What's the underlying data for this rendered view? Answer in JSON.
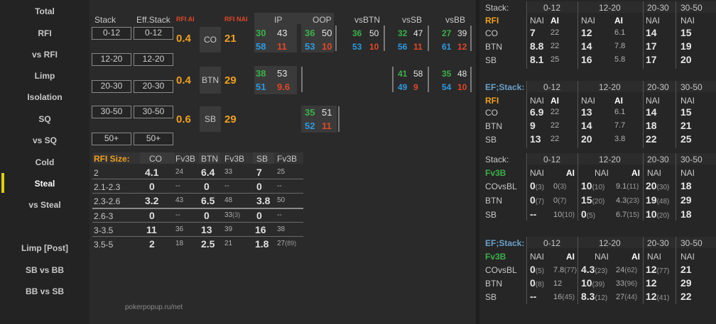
{
  "sidebar": {
    "items": [
      "Total",
      "RFI",
      "vs RFI",
      "Limp",
      "Isolation",
      "SQ",
      "vs SQ",
      "Cold",
      "Steal",
      "vs Steal",
      "Limp [Post]",
      "SB vs BB",
      "BB vs SB"
    ]
  },
  "center": {
    "headers": {
      "stack": "Stack",
      "eff_stack": "Eff.Stack",
      "rfi_ai": "RFI AI",
      "rfi_nai": "RFI NAI",
      "ip": "IP",
      "oop": "OOP",
      "vsbtn": "vsBTN",
      "vssb": "vsSB",
      "vsbb": "vsBB"
    },
    "stack_boxes": [
      [
        "0-12",
        "0-12"
      ],
      [
        "12-20",
        "12-20"
      ],
      [
        "20-30",
        "20-30"
      ],
      [
        "30-50",
        "30-50"
      ],
      [
        "50+",
        "50+"
      ]
    ],
    "rows": [
      {
        "ai": "0.4",
        "pos": "CO",
        "nai": "21",
        "ip": [
          "30",
          "43",
          "58",
          "11"
        ],
        "oop": [
          "36",
          "50",
          "53",
          "10"
        ],
        "vsbtn": [
          "36",
          "50",
          "53",
          "10"
        ],
        "vssb": [
          "32",
          "47",
          "56",
          "11"
        ],
        "vsbb": [
          "27",
          "39",
          "61",
          "12"
        ]
      },
      {
        "ai": "0.4",
        "pos": "BTN",
        "nai": "29",
        "ip": [
          "38",
          "53",
          "51",
          "9.6"
        ],
        "vssb": [
          "41",
          "58",
          "49",
          "9"
        ],
        "vsbb": [
          "35",
          "48",
          "54",
          "10"
        ]
      },
      {
        "ai": "0.6",
        "pos": "SB",
        "nai": "29",
        "vsbb": [
          "35",
          "51",
          "52",
          "11"
        ]
      }
    ],
    "size_table": {
      "headers": [
        "RFI Size:",
        "CO",
        "Fv3B",
        "BTN",
        "Fv3B",
        "SB",
        "Fv3B"
      ],
      "rows": [
        [
          "2",
          "4.1",
          "24",
          "6.4",
          "33",
          "7",
          "25"
        ],
        [
          "2.1-2.3",
          "0",
          "--",
          "0",
          "--",
          "0",
          "--"
        ],
        [
          "2.3-2.6",
          "3.2",
          "43",
          "6.5",
          "48",
          "3.8",
          "50"
        ],
        [
          "2.6-3",
          "0",
          "--",
          "0",
          "33",
          "0",
          "--"
        ],
        [
          "3-3.5",
          "11",
          "36",
          "13",
          "39",
          "16",
          "38"
        ],
        [
          "3.5-5",
          "2",
          "18",
          "2.5",
          "21",
          "1.8",
          "27"
        ]
      ],
      "extra": {
        "r3_btn_fv": "(3)",
        "r5_sb_fv": "(89)"
      }
    },
    "footer": "pokerpopup.ru/net"
  },
  "right": {
    "t1": {
      "title": "Stack:",
      "label": "RFI",
      "cols": [
        "0-12",
        "12-20",
        "20-30",
        "30-50"
      ],
      "sub": [
        "NAI",
        "AI",
        "NAI",
        "AI",
        "NAI",
        "NAI"
      ],
      "rows": [
        [
          "CO",
          "7",
          "22",
          "12",
          "6.1",
          "14",
          "15"
        ],
        [
          "BTN",
          "8.8",
          "22",
          "14",
          "7.8",
          "17",
          "19"
        ],
        [
          "SB",
          "8.1",
          "25",
          "16",
          "5.8",
          "17",
          "20"
        ]
      ]
    },
    "t2": {
      "title": "EF;Stack:",
      "label": "RFI",
      "cols": [
        "0-12",
        "12-20",
        "20-30",
        "30-50"
      ],
      "sub": [
        "NAI",
        "AI",
        "NAI",
        "AI",
        "NAI",
        "NAI"
      ],
      "rows": [
        [
          "CO",
          "6.9",
          "22",
          "13",
          "6.1",
          "14",
          "15"
        ],
        [
          "BTN",
          "9",
          "22",
          "14",
          "7.7",
          "18",
          "21"
        ],
        [
          "SB",
          "13",
          "22",
          "20",
          "3.8",
          "22",
          "25"
        ]
      ]
    },
    "t3": {
      "title": "Stack:",
      "label": "Fv3B",
      "cols": [
        "0-12",
        "12-20",
        "20-30",
        "30-50"
      ],
      "sub": [
        "NAI",
        "AI",
        "NAI",
        "AI",
        "NAI",
        "NAI"
      ],
      "rows": [
        [
          "COvsBL",
          "0",
          "(3)",
          "0",
          "(3)",
          "10",
          "(10)",
          "9.1",
          "(11)",
          "20",
          "(30)",
          "18"
        ],
        [
          "BTN",
          "0",
          "(7)",
          "0",
          "(7)",
          "15",
          "(20)",
          "4.3",
          "(23)",
          "19",
          "(48)",
          "29"
        ],
        [
          "SB",
          "--",
          "",
          "10",
          "(10)",
          "0",
          "(5)",
          "6.7",
          "(15)",
          "10",
          "(20)",
          "18"
        ]
      ]
    },
    "t4": {
      "title": "EF;Stack:",
      "label": "Fv3B",
      "cols": [
        "0-12",
        "12-20",
        "20-30",
        "30-50"
      ],
      "sub": [
        "NAI",
        "AI",
        "NAI",
        "AI",
        "NAI",
        "NAI"
      ],
      "rows": [
        [
          "COvsBL",
          "0",
          "(5)",
          "7.8",
          "(77)",
          "4.3",
          "(23)",
          "24",
          "(62)",
          "12",
          "(77)",
          "21"
        ],
        [
          "BTN",
          "0",
          "(8)",
          "12",
          "",
          "10",
          "(39)",
          "33",
          "(96)",
          "12",
          "",
          "29"
        ],
        [
          "SB",
          "--",
          "",
          "16",
          "(45)",
          "8.3",
          "(12)",
          "27",
          "(44)",
          "12",
          "(41)",
          "22"
        ]
      ]
    }
  }
}
